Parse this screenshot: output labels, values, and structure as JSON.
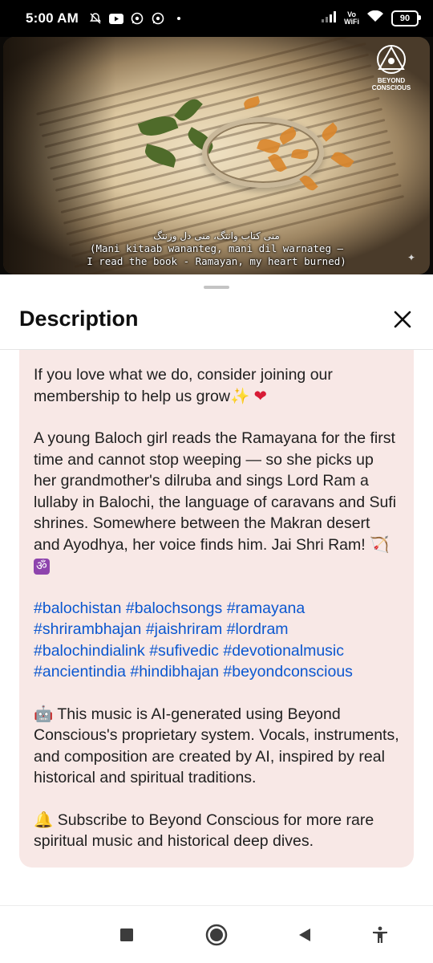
{
  "status_bar": {
    "time": "5:00 AM",
    "vowifi_top": "Vo",
    "vowifi_bottom": "WiFi",
    "battery": "90"
  },
  "video": {
    "logo_line1": "BEYOND",
    "logo_line2": "CONSCIOUS",
    "subtitle_urdu": "منی کتاب وانتگ، منی دل وزنتگ",
    "subtitle_line1": "(Mani kitaab wananteg, mani dil warnateg —",
    "subtitle_line2": "I read the book - Ramayan, my heart burned)",
    "progress_played": 0.15,
    "progress_buffered": 0.22
  },
  "sheet": {
    "title": "Description",
    "close_icon": "close-icon"
  },
  "description": {
    "para1": "If you love what we do, consider joining our membership to help us grow",
    "para1_emoji1": "✨",
    "para1_emoji2": "❤",
    "para2": "A young Baloch girl reads the Ramayana for the first time and cannot stop weeping — so she picks up her grandmother's dilruba and sings Lord Ram a lullaby in Balochi, the language of caravans and Sufi shrines. Somewhere between the Makran desert and Ayodhya, her voice finds him. Jai Shri Ram!",
    "para2_emoji1": "🏹",
    "para2_emoji2": "ॐ",
    "hashtags": [
      "#balochistan",
      "#balochsongs",
      "#ramayana",
      "#shrirambhajan",
      "#jaishriram",
      "#lordram",
      "#balochindialink",
      "#sufivedic",
      "#devotionalmusic",
      "#ancientindia",
      "#hindibhajan",
      "#beyondconscious"
    ],
    "para3_emoji": "🤖",
    "para3": "This music is AI-generated using Beyond Conscious's proprietary system. Vocals, instruments, and composition are created by AI, inspired by real historical and spiritual traditions.",
    "para4_emoji": "🔔",
    "para4": "Subscribe to Beyond Conscious for more rare spiritual music and historical deep dives."
  },
  "colors": {
    "card_bg": "#f8e8e6",
    "hashtag": "#0b57d0",
    "progress": "#ff0033"
  }
}
